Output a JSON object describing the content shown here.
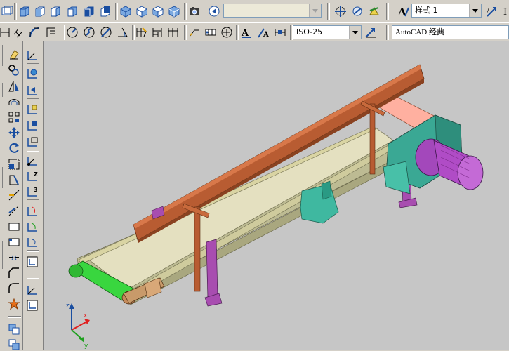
{
  "app": {
    "name": "AutoCAD"
  },
  "toolbar": {
    "view_combo": {
      "value": ""
    },
    "text_style": {
      "label_prefix": "A",
      "value": "样式 1"
    },
    "dim_style": {
      "value": "ISO-25"
    },
    "workspace": {
      "value": "AutoCAD 经典"
    }
  },
  "viewport": {
    "background": "#c6c6c6",
    "ucs_axes": [
      "x",
      "y",
      "z"
    ]
  },
  "colors": {
    "frame": "#c7c5a0",
    "belt": "#e3dfbf",
    "rail": "#b85c32",
    "legs": "#a84db0",
    "motor": "#b04cc6",
    "gearbox": "#3aa894",
    "roller": "#39d63f"
  }
}
